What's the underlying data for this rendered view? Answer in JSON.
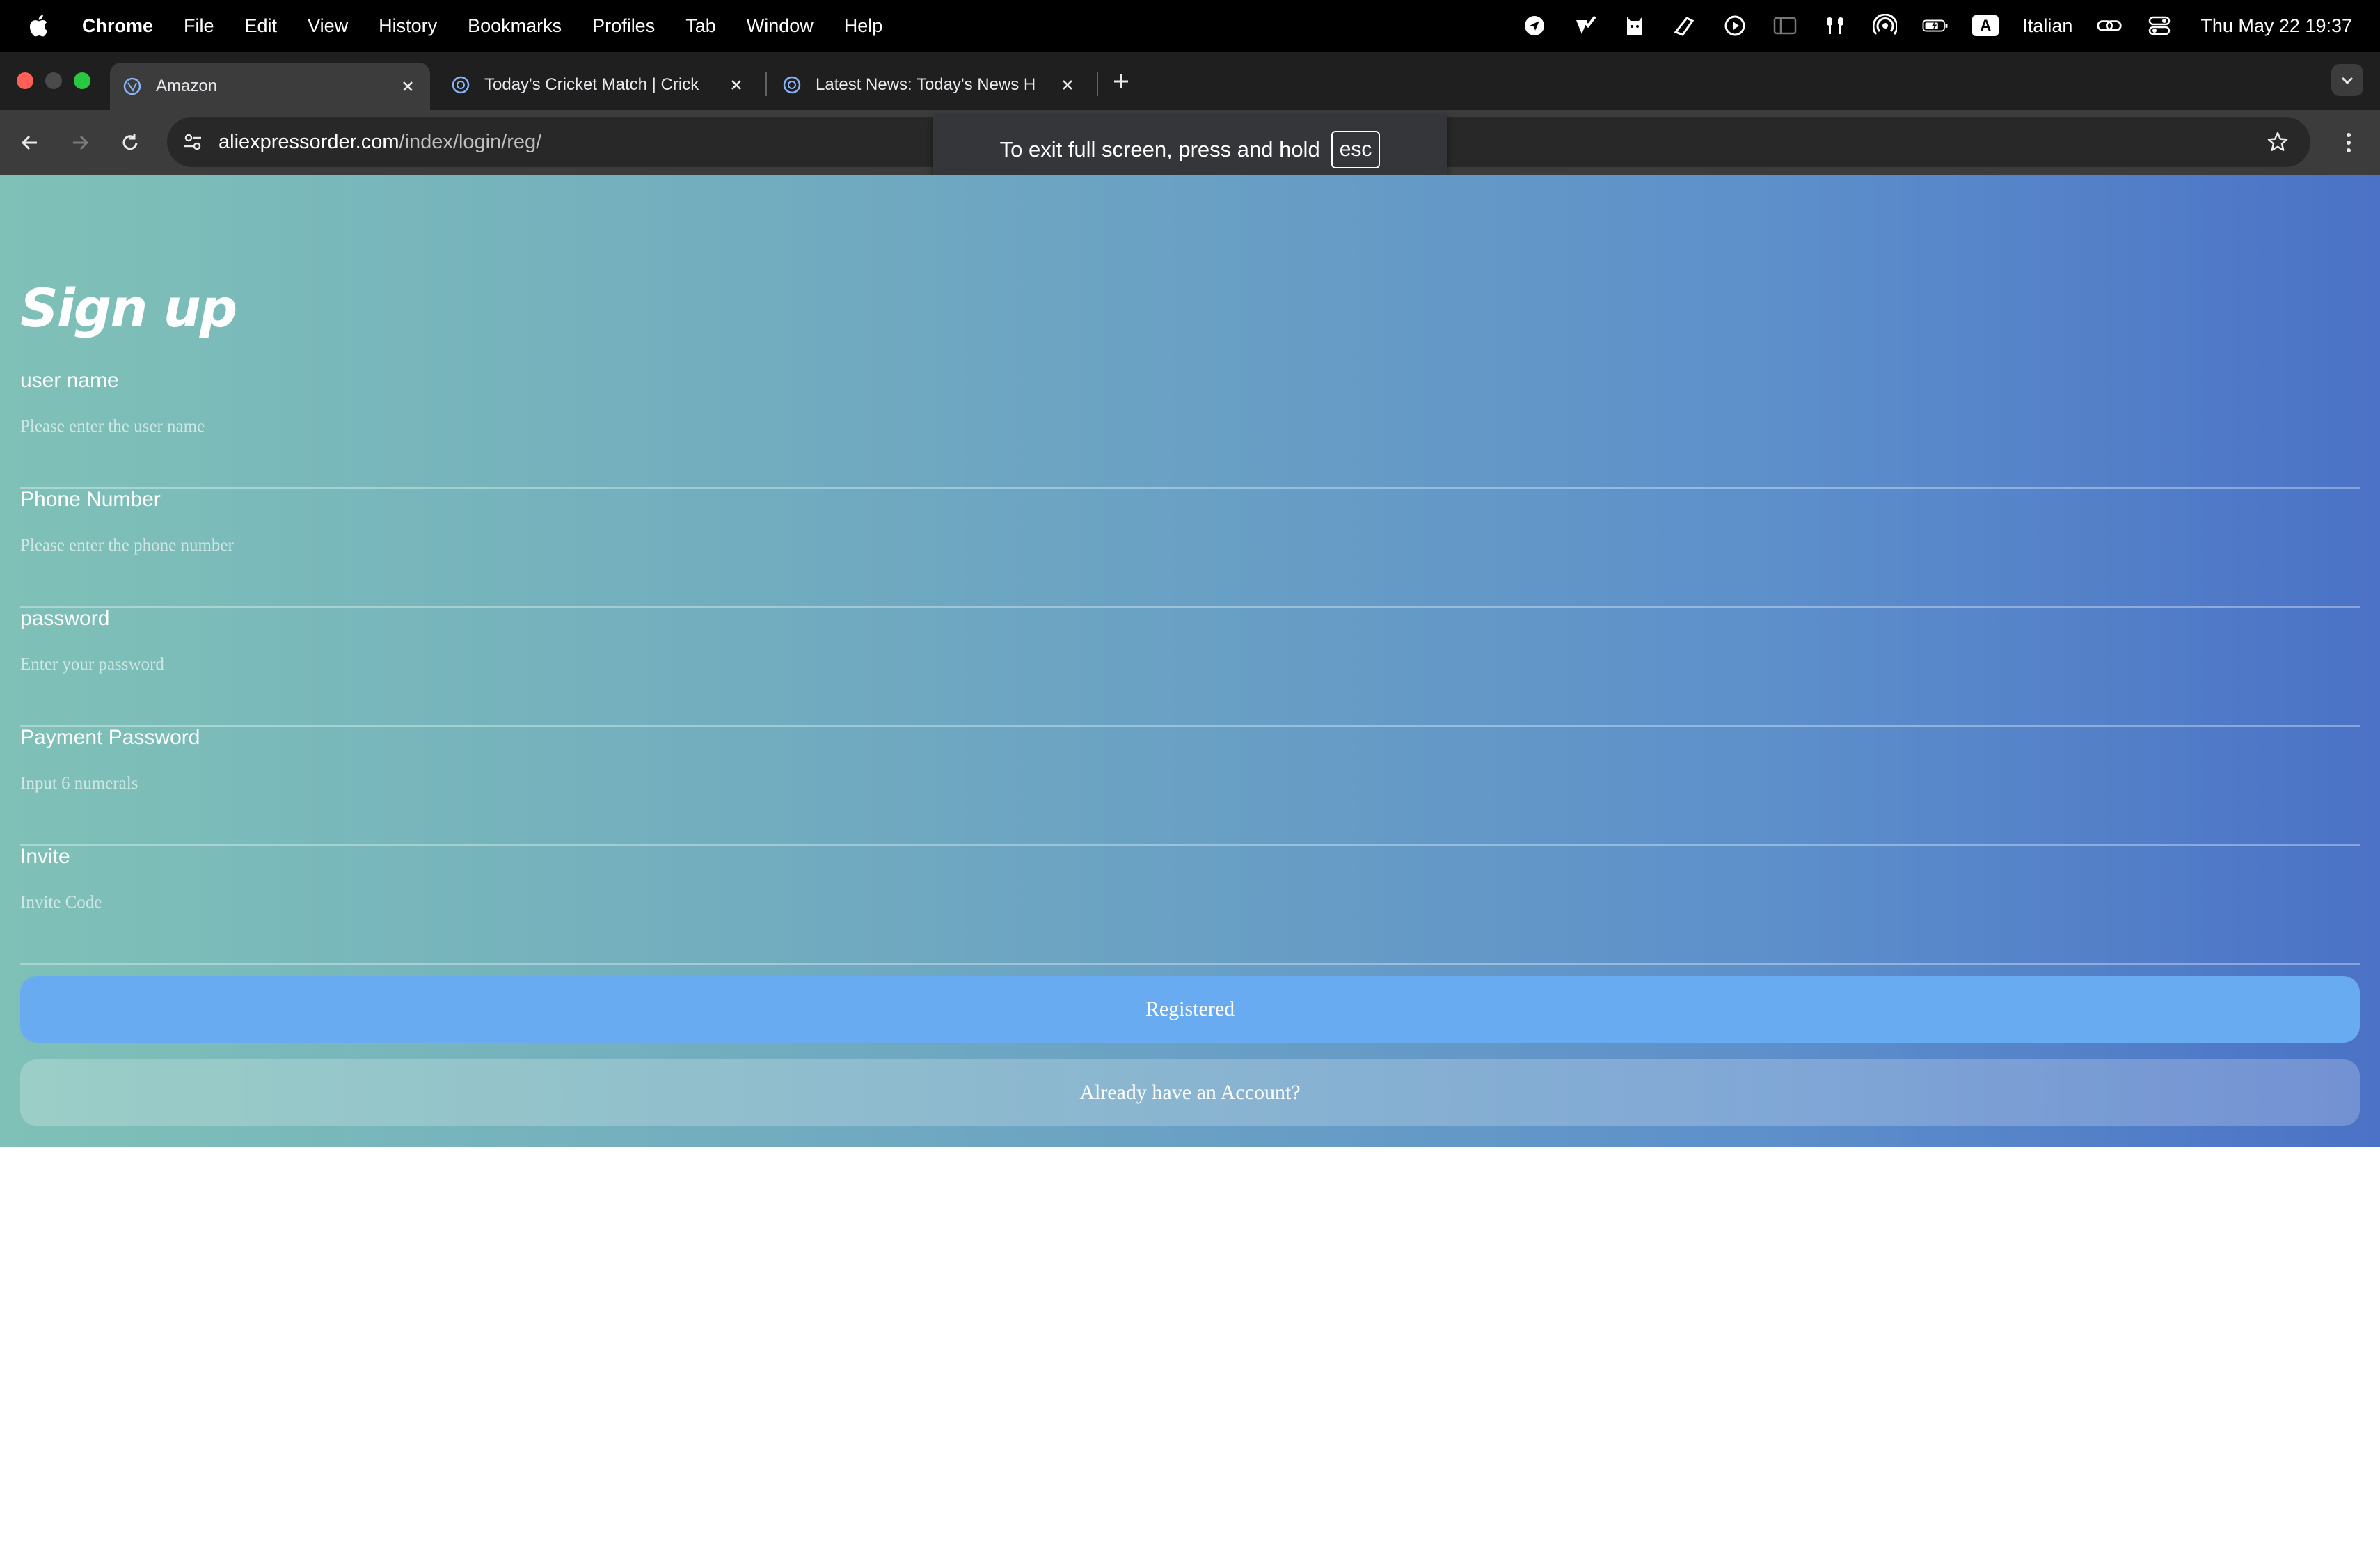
{
  "menubar": {
    "app_name": "Chrome",
    "items": [
      "File",
      "Edit",
      "View",
      "History",
      "Bookmarks",
      "Profiles",
      "Tab",
      "Window",
      "Help"
    ],
    "input_source_badge": "A",
    "input_source": "Italian",
    "clock": "Thu May 22  19:37"
  },
  "tabs": [
    {
      "title": "Amazon",
      "active": true
    },
    {
      "title": "Today's Cricket Match | Crick",
      "active": false
    },
    {
      "title": "Latest News: Today's News H",
      "active": false
    }
  ],
  "address_bar": {
    "host": "aliexpressorder.com",
    "path": "/index/login/reg/"
  },
  "fullscreen_toast": {
    "message": "To exit full screen, press and hold",
    "key": "esc"
  },
  "form": {
    "heading": "Sign up",
    "fields": [
      {
        "label": "user name",
        "placeholder": "Please enter the user name"
      },
      {
        "label": "Phone Number",
        "placeholder": "Please enter the phone number"
      },
      {
        "label": "password",
        "placeholder": "Enter your password"
      },
      {
        "label": "Payment Password",
        "placeholder": "Input 6 numerals"
      },
      {
        "label": "Invite",
        "placeholder": "Invite Code"
      }
    ],
    "submit_label": "Registered",
    "login_link_label": "Already have an Account?"
  },
  "colors": {
    "gradient_start": "#7fc1b7",
    "gradient_end": "#4b72c6",
    "primary_button": "#69abf0"
  }
}
